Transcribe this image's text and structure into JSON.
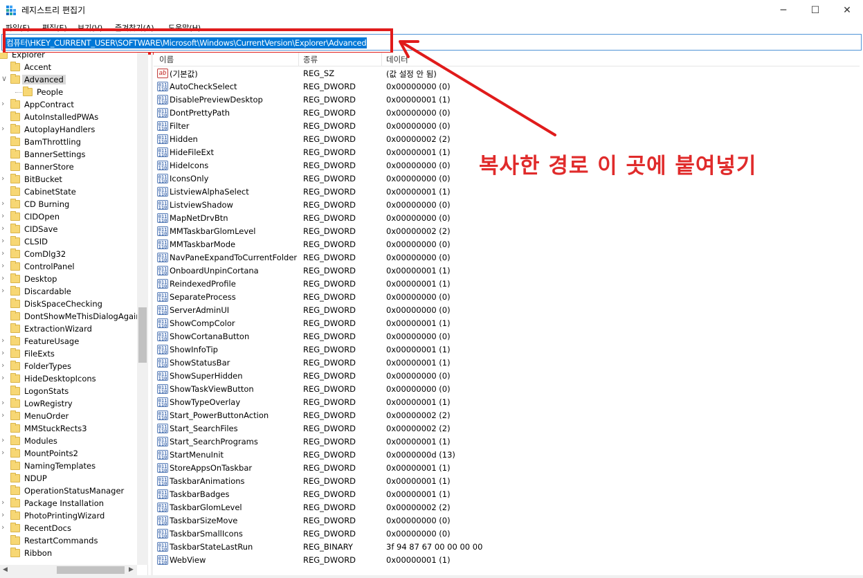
{
  "window": {
    "title": "레지스트리 편집기",
    "minimize_glyph": "─",
    "maximize_glyph": "☐",
    "close_glyph": "✕"
  },
  "menu": [
    "파일(F)",
    "편집(E)",
    "보기(V)",
    "즐겨찾기(A)",
    "도움말(H)"
  ],
  "address": {
    "path": "컴퓨터\\HKEY_CURRENT_USER\\SOFTWARE\\Microsoft\\Windows\\CurrentVersion\\Explorer\\Advanced"
  },
  "annotation": {
    "text": "복사한 경로 이 곳에 붙여넣기",
    "color": "#e02b2b"
  },
  "tree": {
    "items": [
      {
        "label": "Explorer",
        "chev": "",
        "indent": 0
      },
      {
        "label": "Accent",
        "chev": "",
        "indent": 1
      },
      {
        "label": "Advanced",
        "chev": "∨",
        "indent": 1,
        "selected": true
      },
      {
        "label": "People",
        "chev": "",
        "indent": 2
      },
      {
        "label": "AppContract",
        "chev": "›",
        "indent": 1
      },
      {
        "label": "AutoInstalledPWAs",
        "chev": "",
        "indent": 1
      },
      {
        "label": "AutoplayHandlers",
        "chev": "›",
        "indent": 1
      },
      {
        "label": "BamThrottling",
        "chev": "",
        "indent": 1
      },
      {
        "label": "BannerSettings",
        "chev": "",
        "indent": 1
      },
      {
        "label": "BannerStore",
        "chev": "",
        "indent": 1
      },
      {
        "label": "BitBucket",
        "chev": "›",
        "indent": 1
      },
      {
        "label": "CabinetState",
        "chev": "",
        "indent": 1
      },
      {
        "label": "CD Burning",
        "chev": "›",
        "indent": 1
      },
      {
        "label": "CIDOpen",
        "chev": "›",
        "indent": 1
      },
      {
        "label": "CIDSave",
        "chev": "›",
        "indent": 1
      },
      {
        "label": "CLSID",
        "chev": "›",
        "indent": 1
      },
      {
        "label": "ComDlg32",
        "chev": "›",
        "indent": 1
      },
      {
        "label": "ControlPanel",
        "chev": "›",
        "indent": 1
      },
      {
        "label": "Desktop",
        "chev": "›",
        "indent": 1
      },
      {
        "label": "Discardable",
        "chev": "›",
        "indent": 1
      },
      {
        "label": "DiskSpaceChecking",
        "chev": "",
        "indent": 1
      },
      {
        "label": "DontShowMeThisDialogAgain",
        "chev": "",
        "indent": 1
      },
      {
        "label": "ExtractionWizard",
        "chev": "",
        "indent": 1
      },
      {
        "label": "FeatureUsage",
        "chev": "›",
        "indent": 1
      },
      {
        "label": "FileExts",
        "chev": "›",
        "indent": 1
      },
      {
        "label": "FolderTypes",
        "chev": "›",
        "indent": 1
      },
      {
        "label": "HideDesktopIcons",
        "chev": "›",
        "indent": 1
      },
      {
        "label": "LogonStats",
        "chev": "",
        "indent": 1
      },
      {
        "label": "LowRegistry",
        "chev": "›",
        "indent": 1
      },
      {
        "label": "MenuOrder",
        "chev": "›",
        "indent": 1
      },
      {
        "label": "MMStuckRects3",
        "chev": "",
        "indent": 1
      },
      {
        "label": "Modules",
        "chev": "›",
        "indent": 1
      },
      {
        "label": "MountPoints2",
        "chev": "›",
        "indent": 1
      },
      {
        "label": "NamingTemplates",
        "chev": "",
        "indent": 1
      },
      {
        "label": "NDUP",
        "chev": "",
        "indent": 1
      },
      {
        "label": "OperationStatusManager",
        "chev": "",
        "indent": 1
      },
      {
        "label": "Package Installation",
        "chev": "›",
        "indent": 1
      },
      {
        "label": "PhotoPrintingWizard",
        "chev": "›",
        "indent": 1
      },
      {
        "label": "RecentDocs",
        "chev": "›",
        "indent": 1
      },
      {
        "label": "RestartCommands",
        "chev": "",
        "indent": 1
      },
      {
        "label": "Ribbon",
        "chev": "",
        "indent": 1
      }
    ]
  },
  "list": {
    "headers": {
      "name": "이름",
      "type": "종류",
      "data": "데이터"
    },
    "rows": [
      {
        "name": "(기본값)",
        "type": "REG_SZ",
        "data": "(값 설정 안 됨)",
        "icon": "ab"
      },
      {
        "name": "AutoCheckSelect",
        "type": "REG_DWORD",
        "data": "0x00000000 (0)",
        "icon": "dw"
      },
      {
        "name": "DisablePreviewDesktop",
        "type": "REG_DWORD",
        "data": "0x00000001 (1)",
        "icon": "dw"
      },
      {
        "name": "DontPrettyPath",
        "type": "REG_DWORD",
        "data": "0x00000000 (0)",
        "icon": "dw"
      },
      {
        "name": "Filter",
        "type": "REG_DWORD",
        "data": "0x00000000 (0)",
        "icon": "dw"
      },
      {
        "name": "Hidden",
        "type": "REG_DWORD",
        "data": "0x00000002 (2)",
        "icon": "dw"
      },
      {
        "name": "HideFileExt",
        "type": "REG_DWORD",
        "data": "0x00000001 (1)",
        "icon": "dw"
      },
      {
        "name": "HideIcons",
        "type": "REG_DWORD",
        "data": "0x00000000 (0)",
        "icon": "dw"
      },
      {
        "name": "IconsOnly",
        "type": "REG_DWORD",
        "data": "0x00000000 (0)",
        "icon": "dw"
      },
      {
        "name": "ListviewAlphaSelect",
        "type": "REG_DWORD",
        "data": "0x00000001 (1)",
        "icon": "dw"
      },
      {
        "name": "ListviewShadow",
        "type": "REG_DWORD",
        "data": "0x00000000 (0)",
        "icon": "dw"
      },
      {
        "name": "MapNetDrvBtn",
        "type": "REG_DWORD",
        "data": "0x00000000 (0)",
        "icon": "dw"
      },
      {
        "name": "MMTaskbarGlomLevel",
        "type": "REG_DWORD",
        "data": "0x00000002 (2)",
        "icon": "dw"
      },
      {
        "name": "MMTaskbarMode",
        "type": "REG_DWORD",
        "data": "0x00000000 (0)",
        "icon": "dw"
      },
      {
        "name": "NavPaneExpandToCurrentFolder",
        "type": "REG_DWORD",
        "data": "0x00000000 (0)",
        "icon": "dw"
      },
      {
        "name": "OnboardUnpinCortana",
        "type": "REG_DWORD",
        "data": "0x00000001 (1)",
        "icon": "dw"
      },
      {
        "name": "ReindexedProfile",
        "type": "REG_DWORD",
        "data": "0x00000001 (1)",
        "icon": "dw"
      },
      {
        "name": "SeparateProcess",
        "type": "REG_DWORD",
        "data": "0x00000000 (0)",
        "icon": "dw"
      },
      {
        "name": "ServerAdminUI",
        "type": "REG_DWORD",
        "data": "0x00000000 (0)",
        "icon": "dw"
      },
      {
        "name": "ShowCompColor",
        "type": "REG_DWORD",
        "data": "0x00000001 (1)",
        "icon": "dw"
      },
      {
        "name": "ShowCortanaButton",
        "type": "REG_DWORD",
        "data": "0x00000000 (0)",
        "icon": "dw"
      },
      {
        "name": "ShowInfoTip",
        "type": "REG_DWORD",
        "data": "0x00000001 (1)",
        "icon": "dw"
      },
      {
        "name": "ShowStatusBar",
        "type": "REG_DWORD",
        "data": "0x00000001 (1)",
        "icon": "dw"
      },
      {
        "name": "ShowSuperHidden",
        "type": "REG_DWORD",
        "data": "0x00000000 (0)",
        "icon": "dw"
      },
      {
        "name": "ShowTaskViewButton",
        "type": "REG_DWORD",
        "data": "0x00000000 (0)",
        "icon": "dw"
      },
      {
        "name": "ShowTypeOverlay",
        "type": "REG_DWORD",
        "data": "0x00000001 (1)",
        "icon": "dw"
      },
      {
        "name": "Start_PowerButtonAction",
        "type": "REG_DWORD",
        "data": "0x00000002 (2)",
        "icon": "dw"
      },
      {
        "name": "Start_SearchFiles",
        "type": "REG_DWORD",
        "data": "0x00000002 (2)",
        "icon": "dw"
      },
      {
        "name": "Start_SearchPrograms",
        "type": "REG_DWORD",
        "data": "0x00000001 (1)",
        "icon": "dw"
      },
      {
        "name": "StartMenuInit",
        "type": "REG_DWORD",
        "data": "0x0000000d (13)",
        "icon": "dw"
      },
      {
        "name": "StoreAppsOnTaskbar",
        "type": "REG_DWORD",
        "data": "0x00000001 (1)",
        "icon": "dw"
      },
      {
        "name": "TaskbarAnimations",
        "type": "REG_DWORD",
        "data": "0x00000001 (1)",
        "icon": "dw"
      },
      {
        "name": "TaskbarBadges",
        "type": "REG_DWORD",
        "data": "0x00000001 (1)",
        "icon": "dw"
      },
      {
        "name": "TaskbarGlomLevel",
        "type": "REG_DWORD",
        "data": "0x00000002 (2)",
        "icon": "dw"
      },
      {
        "name": "TaskbarSizeMove",
        "type": "REG_DWORD",
        "data": "0x00000000 (0)",
        "icon": "dw"
      },
      {
        "name": "TaskbarSmallIcons",
        "type": "REG_DWORD",
        "data": "0x00000000 (0)",
        "icon": "dw"
      },
      {
        "name": "TaskbarStateLastRun",
        "type": "REG_BINARY",
        "data": "3f 94 87 67 00 00 00 00",
        "icon": "dw"
      },
      {
        "name": "WebView",
        "type": "REG_DWORD",
        "data": "0x00000001 (1)",
        "icon": "dw"
      }
    ]
  }
}
